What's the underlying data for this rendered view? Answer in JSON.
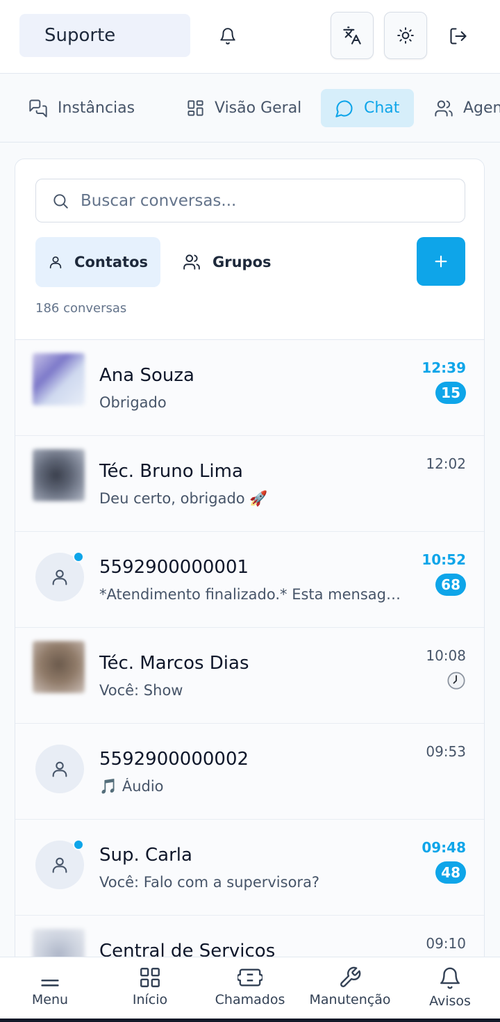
{
  "header": {
    "workspace": "Suporte",
    "icons": [
      "bell-icon",
      "translate-icon",
      "sun-icon",
      "logout-icon"
    ]
  },
  "nav": {
    "tabs": [
      {
        "label": "Instâncias",
        "icon": "messages-icon",
        "active": false
      },
      {
        "label": "Visão Geral",
        "icon": "grid-icon",
        "active": false
      },
      {
        "label": "Chat",
        "icon": "chat-bubble-icon",
        "active": true
      },
      {
        "label": "Agen",
        "icon": "users-icon",
        "active": false
      }
    ]
  },
  "chat": {
    "search_placeholder": "Buscar conversas...",
    "segments": [
      {
        "label": "Contatos",
        "active": true
      },
      {
        "label": "Grupos",
        "active": false
      }
    ],
    "count_label": "186 conversas",
    "conversations": [
      {
        "name": "Ana Souza",
        "preview": "Obrigado",
        "time": "12:39",
        "unread": "15",
        "avatar": "photo"
      },
      {
        "name": "Téc. Bruno Lima",
        "preview": "Deu certo, obrigado 🚀",
        "time": "12:02",
        "unread": "",
        "avatar": "photo"
      },
      {
        "name": "5592900000001",
        "preview": "*Atendimento finalizado.* Esta mensagem foi enviada automaticamente",
        "time": "10:52",
        "unread": "68",
        "avatar": "generic",
        "online": true
      },
      {
        "name": "Téc. Marcos Dias",
        "preview": "Você: Show",
        "time": "10:08",
        "unread": "",
        "avatar": "photo",
        "pending": true
      },
      {
        "name": "5592900000002",
        "preview": "🎵 Áudio",
        "time": "09:53",
        "unread": "",
        "avatar": "generic"
      },
      {
        "name": "Sup. Carla",
        "preview": "Você: Falo com a supervisora?",
        "time": "09:48",
        "unread": "48",
        "avatar": "generic",
        "online": true
      },
      {
        "name": "Central de Serviços",
        "preview": "",
        "time": "09:10",
        "unread": "",
        "avatar": "photo"
      }
    ]
  },
  "bottom_nav": {
    "items": [
      {
        "label": "Menu",
        "icon": "menu-icon"
      },
      {
        "label": "Início",
        "icon": "home-grid-icon"
      },
      {
        "label": "Chamados",
        "icon": "ticket-icon"
      },
      {
        "label": "Manutenção",
        "icon": "wrench-icon"
      },
      {
        "label": "Avisos",
        "icon": "bell-icon"
      }
    ]
  },
  "colors": {
    "accent": "#0ea5e9",
    "active_tab_bg": "#d6eefa",
    "segment_active_bg": "#e6f1fd"
  }
}
